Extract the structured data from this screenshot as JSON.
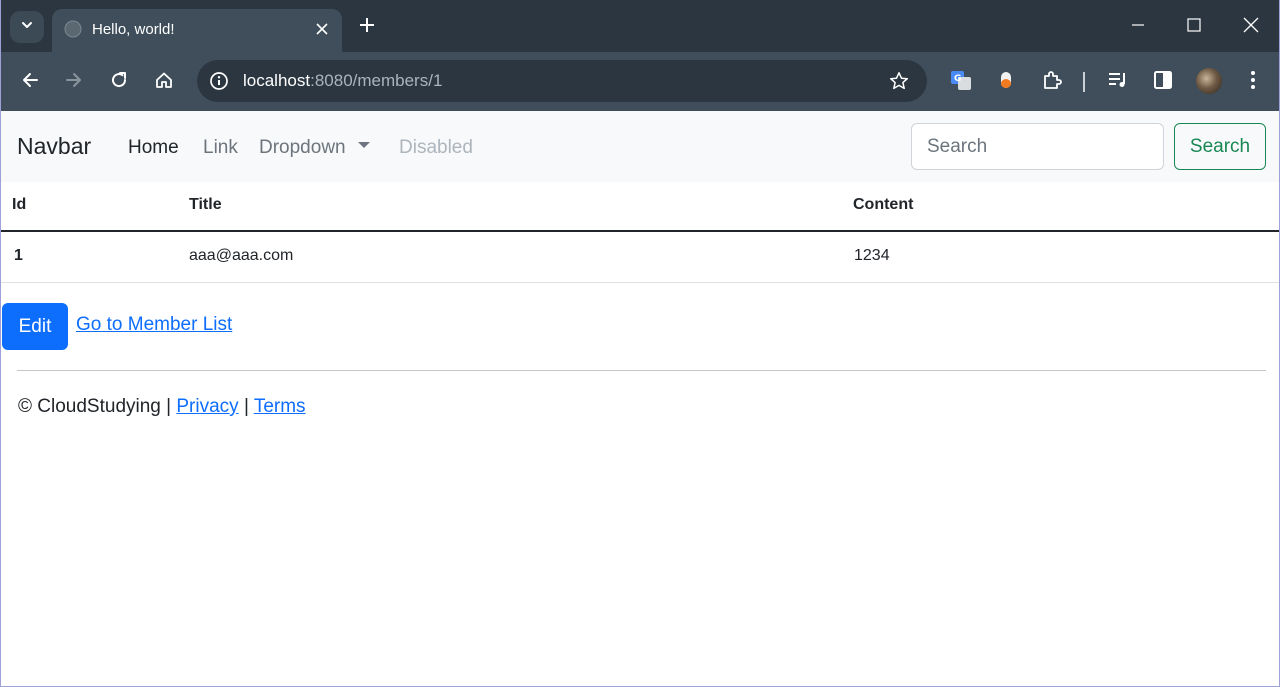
{
  "browser": {
    "tab_title": "Hello, world!",
    "url_host": "localhost",
    "url_rest": ":8080/members/1"
  },
  "navbar": {
    "brand": "Navbar",
    "links": [
      "Home",
      "Link",
      "Dropdown",
      "Disabled"
    ],
    "search_placeholder": "Search",
    "search_button": "Search"
  },
  "table": {
    "headers": [
      "Id",
      "Title",
      "Content"
    ],
    "rows": [
      [
        "1",
        "aaa@aaa.com",
        "1234"
      ]
    ]
  },
  "actions": {
    "edit_label": "Edit",
    "list_link": "Go to Member List"
  },
  "footer": {
    "copyright": "© CloudStudying |",
    "privacy": "Privacy",
    "separator": "|",
    "terms": "Terms"
  },
  "colors": {
    "primary": "#0d6efd",
    "success": "#198754",
    "chrome_dark": "#2b3640",
    "chrome_tab": "#3f4e5a"
  }
}
